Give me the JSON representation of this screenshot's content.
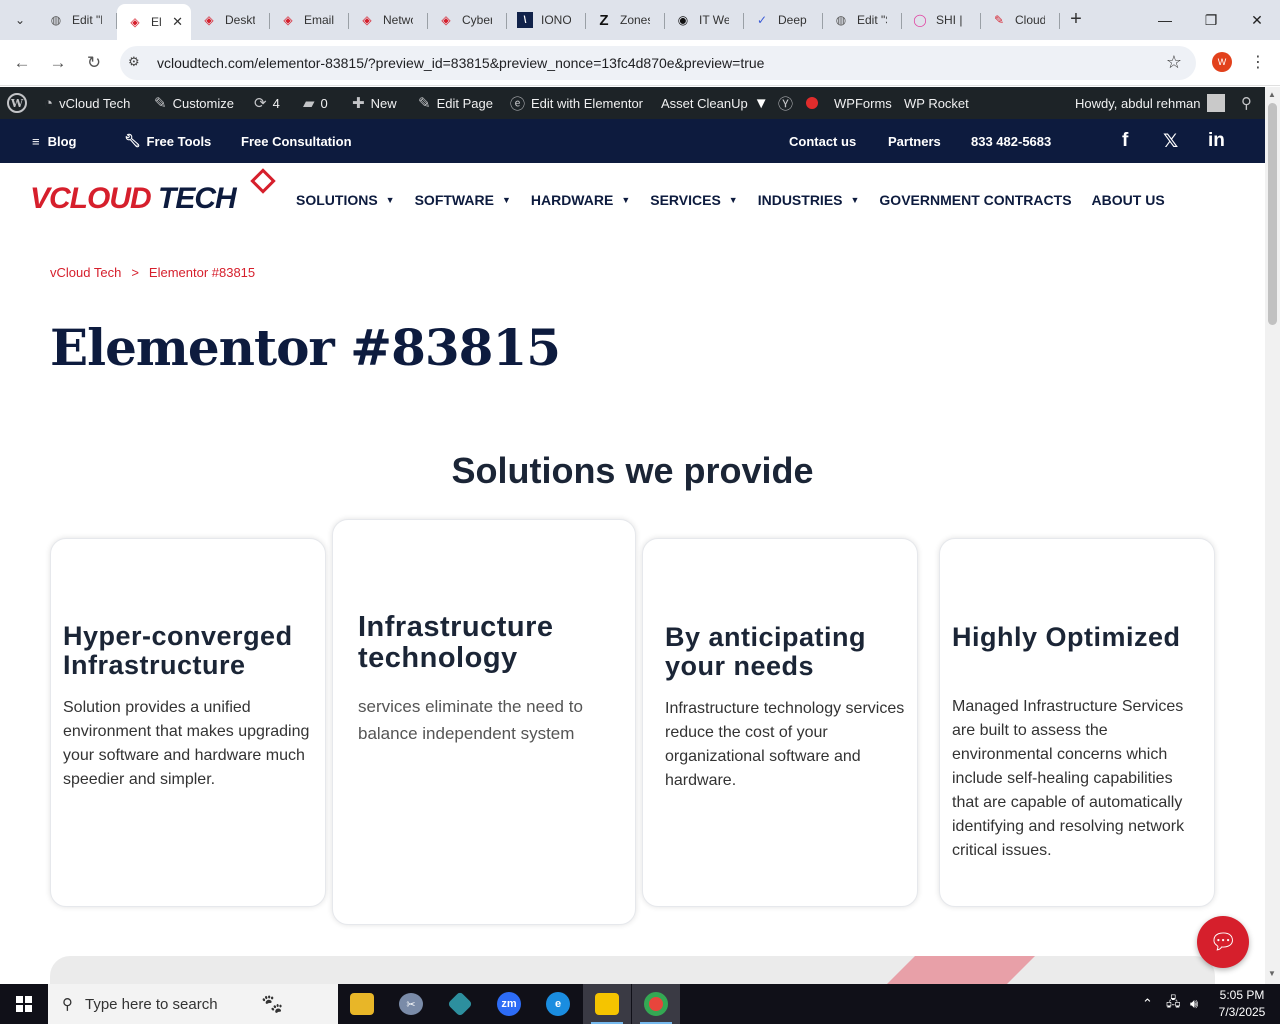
{
  "browser": {
    "tabs": [
      {
        "label": "Edit \"E",
        "icon": "globe-icon"
      },
      {
        "label": "El",
        "icon": "diamond-icon",
        "active": true
      },
      {
        "label": "Deskt",
        "icon": "diamond-icon"
      },
      {
        "label": "Email",
        "icon": "diamond-icon"
      },
      {
        "label": "Netwo",
        "icon": "diamond-icon"
      },
      {
        "label": "Cyber",
        "icon": "diamond-icon"
      },
      {
        "label": "IONO",
        "icon": "ionos-icon"
      },
      {
        "label": "Zones",
        "icon": "zones-icon"
      },
      {
        "label": "IT We",
        "icon": "target-icon"
      },
      {
        "label": "Deep",
        "icon": "deepl-icon"
      },
      {
        "label": "Edit \"S",
        "icon": "globe-icon"
      },
      {
        "label": "SHI |",
        "icon": "ring-icon"
      },
      {
        "label": "Cloud",
        "icon": "pen-icon"
      }
    ],
    "new_tab_label": "+",
    "url": "vcloudtech.com/elementor-83815/?preview_id=83815&preview_nonce=13fc4d870e&preview=true",
    "profile_initial": "W"
  },
  "wpbar": {
    "site_name": "vCloud Tech",
    "customize": "Customize",
    "updates_count": "4",
    "comments_count": "0",
    "new": "New",
    "edit_page": "Edit Page",
    "edit_elementor": "Edit with Elementor",
    "asset_cleanup": "Asset CleanUp",
    "wpforms": "WPForms",
    "wp_rocket": "WP Rocket",
    "howdy": "Howdy, abdul rehman"
  },
  "topnav": {
    "blog": "Blog",
    "free_tools": "Free Tools",
    "free_consultation": "Free Consultation",
    "contact": "Contact us",
    "partners": "Partners",
    "phone": "833 482-5683"
  },
  "logo": {
    "part1": "VCLOUD",
    "part2": "TECH"
  },
  "mainnav": {
    "solutions": "SOLUTIONS",
    "software": "SOFTWARE",
    "hardware": "HARDWARE",
    "services": "SERVICES",
    "industries": "INDUSTRIES",
    "government": "GOVERNMENT CONTRACTS",
    "about": "ABOUT US"
  },
  "breadcrumb": {
    "home": "vCloud Tech",
    "sep": ">",
    "current": "Elementor #83815"
  },
  "page_title": "Elementor #83815",
  "section_title": "Solutions we provide",
  "cards": [
    {
      "title": "Hyper-converged Infrastructure",
      "text": "Solution provides a unified environment that makes upgrading your software and hardware much speedier and simpler."
    },
    {
      "title": "Infrastructure technology",
      "text": "services eliminate the need to balance independent system"
    },
    {
      "title": "By anticipating your needs",
      "text": "Infrastructure technology services reduce the cost of your organizational software and hardware."
    },
    {
      "title": "Highly Optimized",
      "text": "Managed Infrastructure Services are built to assess the environmental concerns which include self-healing capabilities that are capable of automatically identifying and resolving network critical issues."
    }
  ],
  "taskbar": {
    "search_placeholder": "Type here to search",
    "time": "5:05 PM",
    "date": "7/3/2025"
  },
  "colors": {
    "brand_red": "#d61f2c",
    "navy": "#0d1b3e",
    "wp_bar": "#1d2327"
  }
}
